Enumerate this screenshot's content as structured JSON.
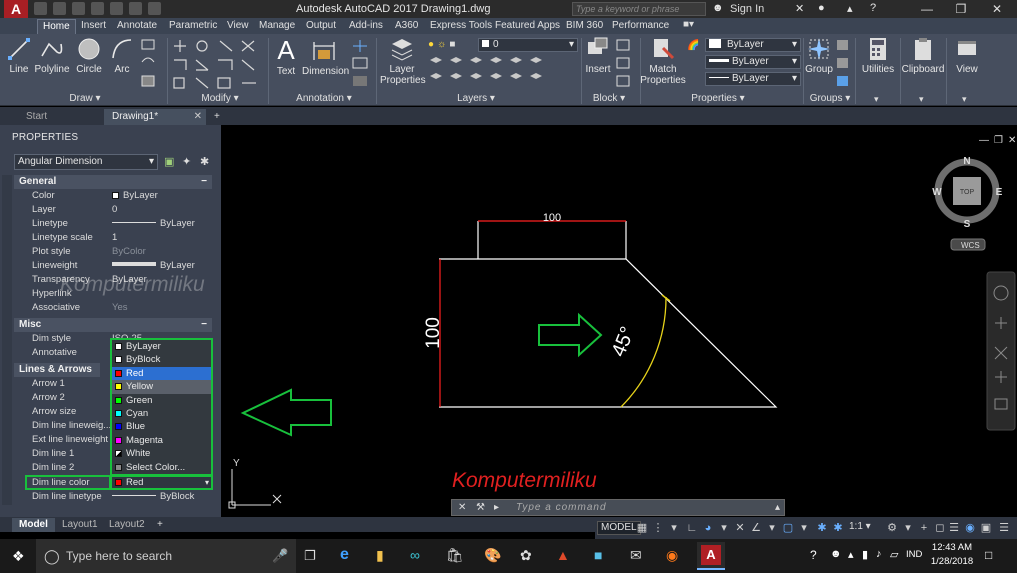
{
  "titlebar": {
    "title": "Autodesk AutoCAD 2017    Drawing1.dwg",
    "search_placeholder": "Type a keyword or phrase",
    "signin": "Sign In"
  },
  "ribbon_tabs": [
    "Home",
    "Insert",
    "Annotate",
    "Parametric",
    "View",
    "Manage",
    "Output",
    "Add-ins",
    "A360",
    "Express Tools",
    "Featured Apps",
    "BIM 360",
    "Performance"
  ],
  "ribbon": {
    "draw": {
      "line": "Line",
      "polyline": "Polyline",
      "circle": "Circle",
      "arc": "Arc",
      "panel": "Draw"
    },
    "modify_panel": "Modify",
    "annotation": {
      "text": "Text",
      "dimension": "Dimension",
      "panel": "Annotation"
    },
    "layers": {
      "layer_properties": "Layer Properties",
      "layer_current": "0",
      "panel": "Layers"
    },
    "block": {
      "insert": "Insert",
      "panel": "Block"
    },
    "properties": {
      "match": "Match Properties",
      "color": "ByLayer",
      "lineweight": "ByLayer",
      "linetype": "ByLayer",
      "panel": "Properties"
    },
    "groups": {
      "group": "Group",
      "panel": "Groups"
    },
    "utilities": "Utilities",
    "clipboard": "Clipboard",
    "view": "View"
  },
  "file_tabs": {
    "start": "Start",
    "drawing": "Drawing1*"
  },
  "properties_palette": {
    "title": "PROPERTIES",
    "object": "Angular Dimension",
    "general": {
      "header": "General",
      "rows": [
        {
          "name": "Color",
          "value": "ByLayer"
        },
        {
          "name": "Layer",
          "value": "0"
        },
        {
          "name": "Linetype",
          "value": "ByLayer"
        },
        {
          "name": "Linetype scale",
          "value": "1"
        },
        {
          "name": "Plot style",
          "value": "ByColor"
        },
        {
          "name": "Lineweight",
          "value": "ByLayer"
        },
        {
          "name": "Transparency",
          "value": "ByLayer"
        },
        {
          "name": "Hyperlink",
          "value": ""
        },
        {
          "name": "Associative",
          "value": "Yes"
        }
      ]
    },
    "misc": {
      "header": "Misc",
      "rows": [
        {
          "name": "Dim style",
          "value": "ISO-25"
        },
        {
          "name": "Annotative",
          "value": ""
        }
      ]
    },
    "lines_arrows": {
      "header": "Lines & Arrows",
      "rows": [
        {
          "name": "Arrow 1",
          "value": ""
        },
        {
          "name": "Arrow 2",
          "value": ""
        },
        {
          "name": "Arrow size",
          "value": ""
        },
        {
          "name": "Dim line lineweig...",
          "value": ""
        },
        {
          "name": "Ext line lineweight",
          "value": ""
        },
        {
          "name": "Dim line 1",
          "value": ""
        },
        {
          "name": "Dim line 2",
          "value": ""
        },
        {
          "name": "Dim line color",
          "value": "Red"
        },
        {
          "name": "Dim line linetype",
          "value": "ByBlock"
        }
      ]
    },
    "color_options": [
      {
        "label": "ByLayer",
        "color": "#ffffff"
      },
      {
        "label": "ByBlock",
        "color": "#ffffff"
      },
      {
        "label": "Red",
        "color": "#ff0000"
      },
      {
        "label": "Yellow",
        "color": "#ffff00"
      },
      {
        "label": "Green",
        "color": "#00ff00"
      },
      {
        "label": "Cyan",
        "color": "#00ffff"
      },
      {
        "label": "Blue",
        "color": "#0000ff"
      },
      {
        "label": "Magenta",
        "color": "#ff00ff"
      },
      {
        "label": "White",
        "color": "#ffffff"
      },
      {
        "label": "Select Color...",
        "color": ""
      }
    ]
  },
  "watermark": "Komputermiliku",
  "drawing": {
    "dim_horizontal": "100",
    "dim_vertical": "100",
    "dim_angle": "45°",
    "watermark": "Komputermiliku"
  },
  "viewcube": {
    "n": "N",
    "s": "S",
    "e": "E",
    "w": "W",
    "top": "TOP",
    "wcs": "WCS"
  },
  "ucs": {
    "y": "Y"
  },
  "command_placeholder": "Type a command",
  "layout_tabs": [
    "Model",
    "Layout1",
    "Layout2"
  ],
  "status": {
    "model": "MODEL",
    "scale": "1:1"
  },
  "taskbar": {
    "search": "Type here to search",
    "lang": "IND",
    "time": "12:43 AM",
    "date": "1/28/2018"
  }
}
